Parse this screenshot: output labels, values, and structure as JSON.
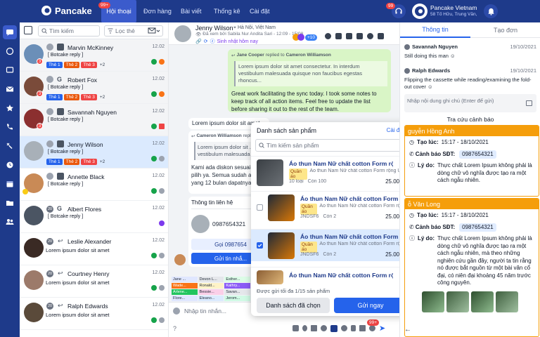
{
  "app": {
    "name": "Pancake",
    "notif_badge": "99+",
    "support_badge": "99"
  },
  "nav": [
    {
      "label": "Hội thoại",
      "active": true
    },
    {
      "label": "Đơn hàng"
    },
    {
      "label": "Bài viết"
    },
    {
      "label": "Thống kê"
    },
    {
      "label": "Cài đặt"
    }
  ],
  "page_info": {
    "name": "Pancake Vietnam",
    "address": "58 Tố Hữu, Trung Văn,"
  },
  "list": {
    "search_placeholder": "Tìm kiếm",
    "filter_label": "Lọc thẻ"
  },
  "conversations": [
    {
      "name": "Marvin McKinney",
      "time": "12.02",
      "reply": "[ Botcake reply ]",
      "tags": [
        "Thẻ 1",
        "Thẻ 2",
        "Thẻ 3"
      ],
      "more": "+2",
      "badge": "3"
    },
    {
      "name": "Robert Fox",
      "time": "12.02",
      "reply": "[ Botcake reply ]",
      "tags": [
        "Thẻ 1",
        "Thẻ 2",
        "Thẻ 3"
      ],
      "more": "+2",
      "badge": "3"
    },
    {
      "name": "Savannah Nguyen",
      "time": "12.02",
      "reply": "[ Botcake reply ]",
      "badge": "3"
    },
    {
      "name": "Jenny Wilson",
      "time": "12.02",
      "reply": "[ Botcake reply ]",
      "tags": [
        "Thẻ 1",
        "Thẻ 2",
        "Thẻ 3"
      ],
      "more": "+2"
    },
    {
      "name": "Annette Black",
      "time": "12.02",
      "reply": "[ Botcake reply ]"
    },
    {
      "name": "Albert Flores",
      "time": "12.02",
      "reply": "[ Botcake reply ]",
      "count": "20"
    },
    {
      "name": "Leslie Alexander",
      "time": "12.02",
      "message": "Lorem ipsum dolor sit amet",
      "count": "20"
    },
    {
      "name": "Courtney Henry",
      "time": "12.02",
      "message": "Lorem ipsum dolor sit amet",
      "count": "20"
    },
    {
      "name": "Ralph Edwards",
      "time": "12.02",
      "message": "Lorem ipsum dolor sit amet",
      "count": "20"
    }
  ],
  "chat": {
    "name": "Jenny Wilson",
    "location": "Hà Nội, Việt Nam",
    "seen": "Đã xem bởi Sabila Nur Andita Sari - 12:09 - 15/08",
    "birthday": "Sinh nhật hôm nay",
    "extra_count": "+10",
    "reply1": {
      "from": "Jane Cooper",
      "verb": "replied to",
      "to": "Cameron Williamson",
      "quote": "Lorem ipsum dolor sit amet consectetur. In interdum vestibulum malesuada quisque non faucibus egestas rhoncus...",
      "text": "Great work facilitating the sync today. I took some notes to keep track of all action items. Feel free to update the list before sharing it out to the rest of the team."
    },
    "msg2": "Lorem ipsum dolor sit amet",
    "reply2": {
      "from": "Cameron Williamson",
      "verb": "replied to",
      "quote": "Lorem ipsum dolor sit ... vestibulum malesuada q...",
      "text": "Kami ada diskon sesuai d... pilih ya. Semua sudah ad... yang 12 bulan dapatnya l..."
    },
    "contact": {
      "title": "Thông tin liên hệ",
      "phone": "0987654321",
      "call_label": "Gọi 0987654",
      "send_label": "Gửi tin nhắ..."
    },
    "input_placeholder": "Nhập tin nhắn...",
    "quick": [
      "Jane ...",
      "Devon L...",
      "Esther...",
      "Wade...",
      "Ronald...",
      "Kathry...",
      "Arlene...",
      "Bessie...",
      "Savan...",
      "Flore...",
      "Eleano...",
      "Jerom..."
    ],
    "toolbar_badge": "99+"
  },
  "popup": {
    "title": "Danh sách sản phẩm",
    "settings": "Cài đặt",
    "search_placeholder": "Tìm kiếm sản phẩm",
    "products": [
      {
        "title": "Áo thun Nam Nữ chất cotton Form rộng Unis...",
        "category": "Quần áo",
        "desc": "Áo thun Nam Nữ chất cotton Form rộng Unis...",
        "code": "10 loại",
        "stock": "Còn 100",
        "price": "25.000đ"
      },
      {
        "title": "Áo thun Nam Nữ chất cotton Form rộng Unis...",
        "category": "Quần áo",
        "desc": "Áo thun Nam Nữ chất cotton Form rộng Unis...",
        "code": "JNDSF6",
        "stock": "Còn 2",
        "price": "25.000đ"
      },
      {
        "title": "Áo thun Nam Nữ chất cotton Form rộng Unis...",
        "category": "Quần áo",
        "desc": "Áo thun Nam Nữ chất cotton Form rộng Unis...",
        "code": "JNDSF6",
        "stock": "Còn 2",
        "price": "25.000đ",
        "checked": true
      },
      {
        "title": "Áo thun Nam Nữ chất cotton Form rộng Unis..."
      }
    ],
    "limit_note": "Được gửi tối đa 1/15 sản phẩm",
    "selected_btn": "Danh sách đã chọn",
    "send_btn": "Gửi ngay"
  },
  "right": {
    "tabs": [
      "Thông tin",
      "Tạo đơn"
    ],
    "notes": [
      {
        "author": "Savannah Nguyen",
        "date": "19/10/2021",
        "text": "Still doing this man"
      },
      {
        "author": "Ralph Edwards",
        "date": "19/10/2021",
        "text": "Flipping the cassette while reading/examining the fold-out cover"
      }
    ],
    "note_placeholder": "Nhập nội dung ghi chú (Enter để gửi)",
    "lookup_title": "Tra cứu cảnh báo",
    "warnings": [
      {
        "name": "guyễn Hồng Anh",
        "time_label": "Tạo lúc:",
        "time": "15:17 - 18/10/2021",
        "phone_label": "Cảnh báo SĐT:",
        "phone": "0987654321",
        "reason_label": "Lý do:",
        "reason": "Thực chất Lorem Ipsum không phải là dòng chữ vô nghĩa được tạo ra một cách ngẫu nhiên."
      },
      {
        "name": "ỗ Văn Long",
        "time_label": "Tạo lúc:",
        "time": "15:17 - 18/10/2021",
        "phone_label": "Cảnh báo SĐT:",
        "phone": "0987654321",
        "reason_label": "Lý do:",
        "reason": "Thực chất Lorem Ipsum không phải là dòng chữ vô nghĩa được tạo ra một cách ngẫu nhiên, mà theo những nghiên cứu gần đây, người ta tin rằng nó được bắt nguồn từ một bài văn cổ đại, có niên đại khoảng 45 năm trước công nguyên."
      }
    ]
  },
  "colors": {
    "brand": "#1e3a8a",
    "accent": "#2563eb",
    "warning": "#f59e0b"
  }
}
